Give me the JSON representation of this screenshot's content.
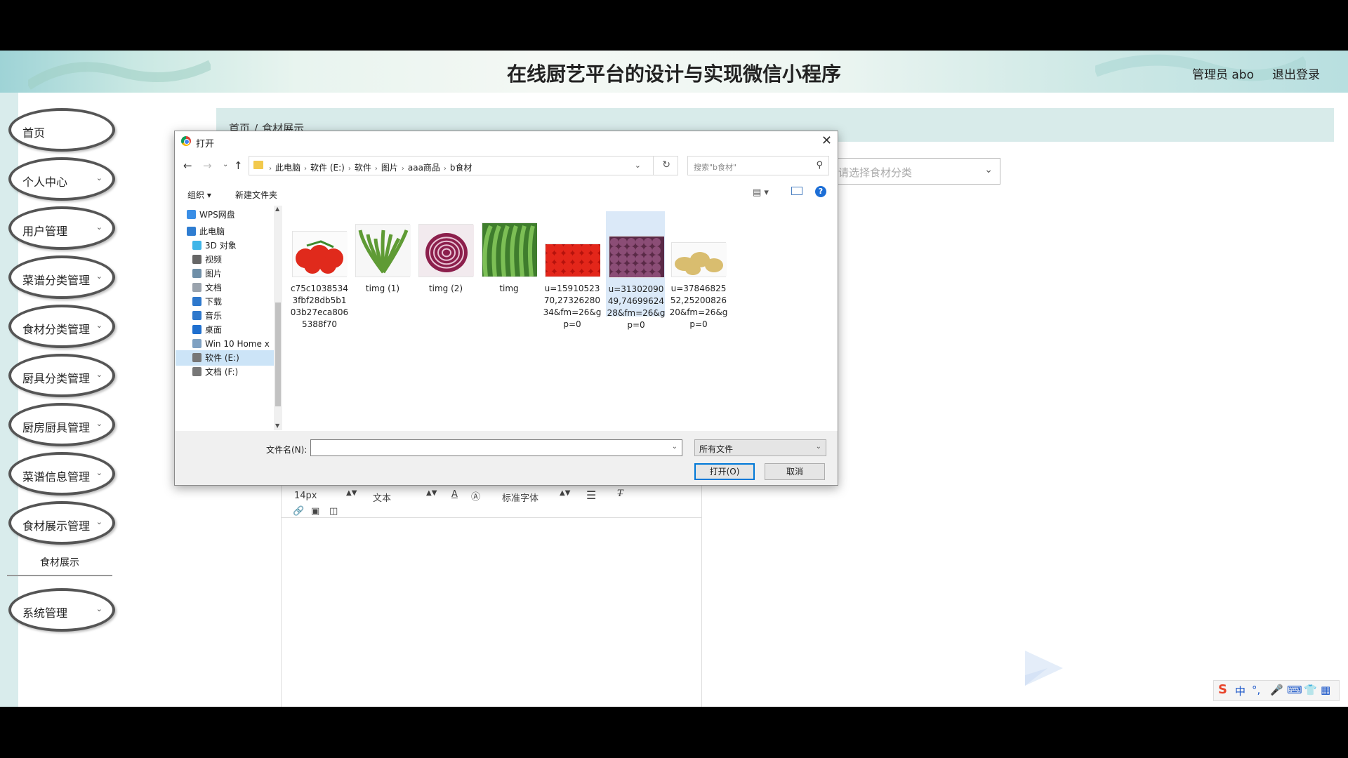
{
  "header": {
    "site_title": "在线厨艺平台的设计与实现微信小程序",
    "user_label": "管理员 abo",
    "logout": "退出登录"
  },
  "sidebar": {
    "items": [
      {
        "label": "首页",
        "has_chevron": false
      },
      {
        "label": "个人中心",
        "has_chevron": true
      },
      {
        "label": "用户管理",
        "has_chevron": true
      },
      {
        "label": "菜谱分类管理",
        "has_chevron": true
      },
      {
        "label": "食材分类管理",
        "has_chevron": true
      },
      {
        "label": "厨具分类管理",
        "has_chevron": true
      },
      {
        "label": "厨房厨具管理",
        "has_chevron": true
      },
      {
        "label": "菜谱信息管理",
        "has_chevron": true
      },
      {
        "label": "食材展示管理",
        "has_chevron": true
      },
      {
        "label": "系统管理",
        "has_chevron": true
      }
    ],
    "sub_item": "食材展示"
  },
  "breadcrumb": {
    "home": "首页",
    "sep": "/",
    "current": "食材展示"
  },
  "category_select": {
    "placeholder": "请选择食材分类"
  },
  "editor": {
    "font_size": "14px",
    "block_type": "文本",
    "font_family": "标准字体"
  },
  "ime": {
    "mode": "中",
    "punct": "°,"
  },
  "dialog": {
    "title": "打开",
    "path": [
      "此电脑",
      "软件 (E:)",
      "软件",
      "图片",
      "aaa商品",
      "b食材"
    ],
    "search_placeholder": "搜索\"b食材\"",
    "organize": "组织 ▾",
    "new_folder": "新建文件夹",
    "help": "?",
    "nav_items": [
      {
        "label": "WPS网盘",
        "level": "top",
        "color": "#3a8ee6",
        "selected": false
      },
      {
        "label": "此电脑",
        "level": "top",
        "color": "#2f7dd1",
        "selected": false
      },
      {
        "label": "3D 对象",
        "level": "sub",
        "color": "#3fb5e8",
        "selected": false
      },
      {
        "label": "视频",
        "level": "sub",
        "color": "#666666",
        "selected": false
      },
      {
        "label": "图片",
        "level": "sub",
        "color": "#6f8fa8",
        "selected": false
      },
      {
        "label": "文档",
        "level": "sub",
        "color": "#9aa3ad",
        "selected": false
      },
      {
        "label": "下载",
        "level": "sub",
        "color": "#2e78cc",
        "selected": false
      },
      {
        "label": "音乐",
        "level": "sub",
        "color": "#2e78cc",
        "selected": false
      },
      {
        "label": "桌面",
        "level": "sub",
        "color": "#1f6fcf",
        "selected": false
      },
      {
        "label": "Win 10 Home x",
        "level": "sub",
        "color": "#7fa1c2",
        "selected": false
      },
      {
        "label": "软件 (E:)",
        "level": "sub",
        "color": "#777777",
        "selected": true
      },
      {
        "label": "文档 (F:)",
        "level": "sub",
        "color": "#777777",
        "selected": false
      }
    ],
    "files": [
      {
        "name": "c75c10385343fbf28db5b103b27eca8065388f70",
        "thumb": "tomatoes-cluster",
        "selected": false
      },
      {
        "name": "timg (1)",
        "thumb": "rocket-greens",
        "selected": false
      },
      {
        "name": "timg (2)",
        "thumb": "red-onion",
        "selected": false
      },
      {
        "name": "timg",
        "thumb": "arugula",
        "selected": false
      },
      {
        "name": "u=1591052370,2732628034&fm=26&gp=0",
        "thumb": "tomato-pile",
        "selected": false
      },
      {
        "name": "u=3130209049,7469962428&fm=26&gp=0",
        "thumb": "shallots",
        "selected": true
      },
      {
        "name": "u=3784682552,2520082620&fm=26&gp=0",
        "thumb": "potatoes",
        "selected": false
      }
    ],
    "filename_label": "文件名(N):",
    "filename_value": "",
    "filetype": "所有文件",
    "open": "打开(O)",
    "cancel": "取消"
  }
}
